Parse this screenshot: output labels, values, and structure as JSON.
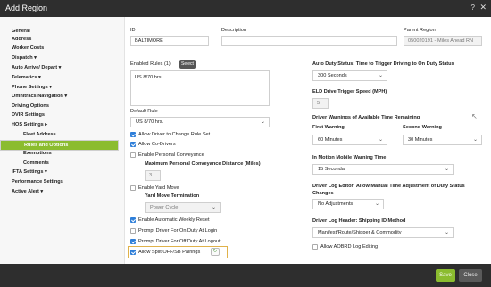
{
  "window": {
    "title": "Add Region",
    "help": "?",
    "close": "✕"
  },
  "sidebar": {
    "items": [
      {
        "label": "General"
      },
      {
        "label": "Address"
      },
      {
        "label": "Worker Costs"
      },
      {
        "label": "Dispatch ▾"
      },
      {
        "label": "Auto Arrive/ Depart ▾"
      },
      {
        "label": "Telematics ▾"
      },
      {
        "label": "Phone Settings ▾"
      },
      {
        "label": "Omnitracs Navigation ▾"
      },
      {
        "label": "Driving Options"
      },
      {
        "label": "DVIR Settings"
      },
      {
        "label": "HOS Settings ▸"
      },
      {
        "label": "Fleet Address"
      },
      {
        "label": "Rules and Options"
      },
      {
        "label": "Exemptions"
      },
      {
        "label": "Comments"
      },
      {
        "label": "IFTA Settings ▾"
      },
      {
        "label": "Performance Settings"
      },
      {
        "label": "Active Alert ▾"
      }
    ]
  },
  "header": {
    "id_label": "ID",
    "id_value": "BALTIMORE",
    "description_label": "Description",
    "description_value": "",
    "parent_label": "Parent Region",
    "parent_value": "050020191 - Miles Ahead RN"
  },
  "left": {
    "enabled_rules_label": "Enabled Rules (1)",
    "select_button": "Select",
    "rules_value": "US 8/70 hrs.",
    "default_rule_label": "Default Rule",
    "default_rule_value": "US 8/70 hrs.",
    "allow_change_rule": "Allow Driver to Change Rule Set",
    "allow_codrivers": "Allow Co-Drivers",
    "enable_pc": "Enable Personal Conveyance",
    "max_pc_label": "Maximum Personal Conveyance Distance (Miles)",
    "max_pc_value": "3",
    "enable_ym": "Enable Yard Move",
    "ym_termination_label": "Yard Move Termination",
    "ym_termination_value": "Power Cycle",
    "weekly_reset": "Enable Automatic Weekly Reset",
    "prompt_on": "Prompt Driver For On Duty At Login",
    "prompt_off": "Prompt Driver For Off Duty At Logout",
    "split_label": "Allow Split OFF/SB Pairings",
    "reset_icon": "↻"
  },
  "right": {
    "auto_duty_label": "Auto Duty Status: Time to Trigger Driving to On Duty Status",
    "auto_duty_value": "300 Seconds",
    "eld_speed_label": "ELD Drive Trigger Speed (MPH)",
    "eld_speed_value": "5",
    "warnings_label": "Driver Warnings of Available Time Remaining",
    "first_warning_label": "First Warning",
    "first_warning_value": "60 Minutes",
    "second_warning_label": "Second Warning",
    "second_warning_value": "30 Minutes",
    "in_motion_label": "In Motion Mobile Warning Time",
    "in_motion_value": "15 Seconda",
    "log_editor_label_1": "Driver Log Editor: Allow Manual Time Adjustment of Duty Status",
    "log_editor_label_2": "Changes",
    "log_editor_value": "No Adjustments",
    "log_header_label": "Driver Log Header: Shipping ID Method",
    "log_header_value": "Manifest/Route/Shipper & Commodity",
    "aobrd_label": "Allow AOBRD Log Editing"
  },
  "footer": {
    "save": "Save",
    "close": "Close"
  },
  "colors": {
    "accent": "#8bbc2f",
    "checkbox": "#2f7fd9",
    "highlight": "#e0b24a",
    "titlebar": "#2e2e2e"
  }
}
